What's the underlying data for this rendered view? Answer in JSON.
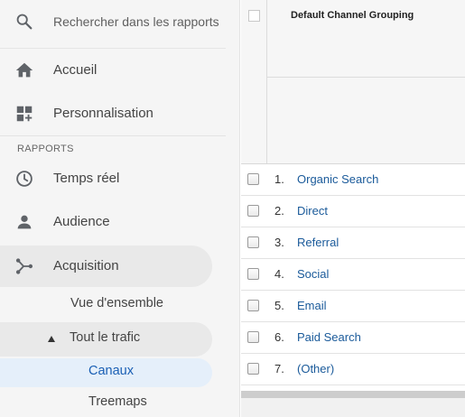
{
  "search": {
    "placeholder": "Rechercher dans les rapports"
  },
  "nav": {
    "home": "Accueil",
    "customization": "Personnalisation",
    "section_reports": "RAPPORTS",
    "realtime": "Temps réel",
    "audience": "Audience",
    "acquisition": "Acquisition"
  },
  "acquisition_sub": {
    "overview": "Vue d'ensemble",
    "all_traffic": "Tout le trafic",
    "channels": "Canaux",
    "treemaps": "Treemaps"
  },
  "table": {
    "column_header": "Default Channel Grouping",
    "rows": [
      {
        "num": "1.",
        "label": "Organic Search"
      },
      {
        "num": "2.",
        "label": "Direct"
      },
      {
        "num": "3.",
        "label": "Referral"
      },
      {
        "num": "4.",
        "label": "Social"
      },
      {
        "num": "5.",
        "label": "Email"
      },
      {
        "num": "6.",
        "label": "Paid Search"
      },
      {
        "num": "7.",
        "label": "(Other)"
      }
    ]
  },
  "colors": {
    "link": "#1a5a9a",
    "active_bg": "#e5effa",
    "active_text": "#1a5fb4",
    "sidebar_bg": "#f5f5f5"
  }
}
